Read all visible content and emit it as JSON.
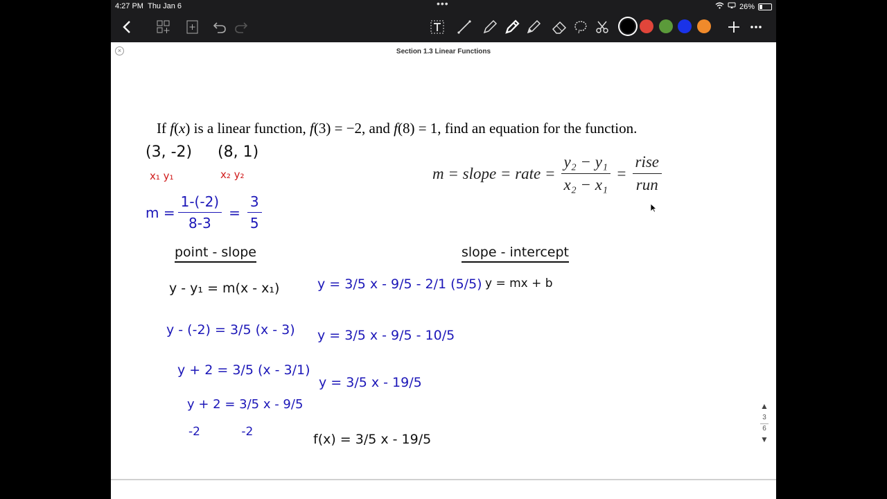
{
  "status": {
    "time": "4:27 PM",
    "date": "Thu Jan 6",
    "battery": "26%",
    "battery_level": 0.26
  },
  "toolbar": {
    "colors": [
      "#000000",
      "#e0453a",
      "#5b9a3a",
      "#1a33e8",
      "#f08a2b"
    ],
    "selected_color": "#000000",
    "icons": [
      "back-icon",
      "thumbnails-icon",
      "add-page-icon",
      "undo-icon",
      "redo-icon",
      "text-tool-icon",
      "line-tool-icon",
      "pen-icon",
      "highlighter-icon",
      "pencil-icon",
      "eraser-icon",
      "lasso-icon",
      "scissors-icon",
      "add-icon",
      "more-icon"
    ]
  },
  "document": {
    "title": "Section 1.3 Linear Functions"
  },
  "problem": {
    "p1": "If ",
    "fx": "f",
    "p2": "(",
    "x": "x",
    "p3": ") is a linear function,  ",
    "f1": "f",
    "p4": "(3) = −2, and  ",
    "f2": "f",
    "p5": "(8) = 1, find an equation for the function."
  },
  "formula": {
    "lhs": "m = slope = rate =",
    "num1": "y₂ − y₁",
    "den1": "x₂ − x₁",
    "eq": "=",
    "num2": "rise",
    "den2": "run"
  },
  "handwriting": {
    "points": {
      "p1": "(3, -2)",
      "p2": "(8, 1)",
      "labels1": "x₁  y₁",
      "labels2": "x₂  y₂"
    },
    "slope": {
      "m": "m =",
      "num": "1-(-2)",
      "den": "8-3",
      "eq": "=",
      "rnum": "3",
      "rden": "5"
    },
    "point_slope": {
      "heading": "point - slope",
      "lines": [
        "y - y₁ = m(x - x₁)",
        "y - (-2) = 3/5 (x - 3)",
        "y + 2 = 3/5 (x - 3/1)",
        "y + 2 = 3/5 x - 9/5",
        "-2           -2"
      ]
    },
    "solve": {
      "lines": [
        "y = 3/5 x - 9/5 - 2/1 (5/5)",
        "y = 3/5 x - 9/5 - 10/5",
        "y = 3/5 x - 19/5",
        "f(x) = 3/5 x - 19/5"
      ]
    },
    "slope_intercept": {
      "heading": "slope - intercept",
      "formula": "y = mx + b"
    }
  },
  "page_nav": {
    "current": "3",
    "total": "6"
  }
}
